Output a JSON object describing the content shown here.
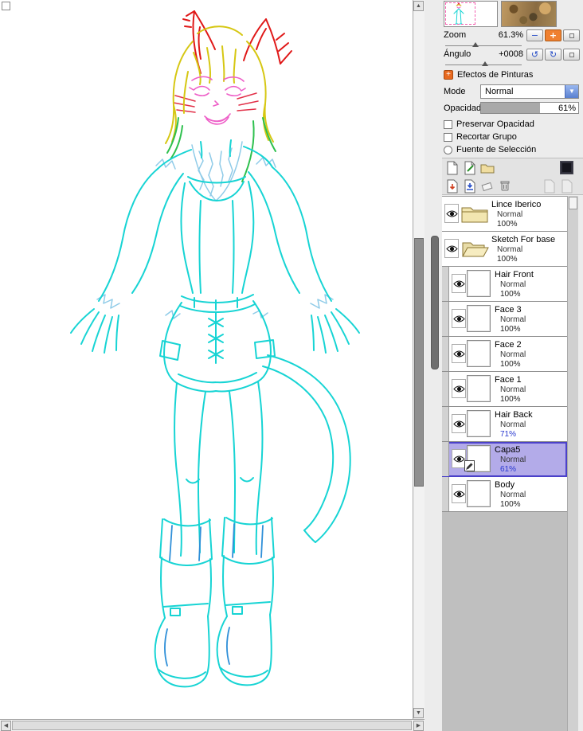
{
  "navigator": {
    "zoom_label": "Zoom",
    "zoom_value": "61.3%",
    "angle_label": "Ángulo",
    "angle_value": "+0008"
  },
  "effects": {
    "header": "Efectos de Pinturas",
    "mode_label": "Mode",
    "mode_value": "Normal",
    "opacity_label": "Opacidad",
    "opacity_value": "61%",
    "checkboxes": [
      {
        "label": "Preservar Opacidad"
      },
      {
        "label": "Recortar Grupo"
      },
      {
        "label": "Fuente de Selección"
      }
    ]
  },
  "layers": [
    {
      "name": "Lince Iberico",
      "mode": "Normal",
      "opacity": "100%"
    },
    {
      "name": "Sketch For base",
      "mode": "Normal",
      "opacity": "100%"
    },
    {
      "name": "Hair Front",
      "mode": "Normal",
      "opacity": "100%"
    },
    {
      "name": "Face 3",
      "mode": "Normal",
      "opacity": "100%"
    },
    {
      "name": "Face 2",
      "mode": "Normal",
      "opacity": "100%"
    },
    {
      "name": "Face 1",
      "mode": "Normal",
      "opacity": "100%"
    },
    {
      "name": "Hair Back",
      "mode": "Normal",
      "opacity": "71%"
    },
    {
      "name": "Capa5",
      "mode": "Normal",
      "opacity": "61%"
    },
    {
      "name": "Body",
      "mode": "Normal",
      "opacity": "100%"
    }
  ],
  "icons": {
    "minus": "−",
    "plus": "+",
    "rotate_ccw": "↺",
    "rotate_cw": "↻",
    "dropdown_arrow": "▼",
    "up_arrow": "▲",
    "down_arrow": "▼",
    "left_arrow": "◀",
    "right_arrow": "▶",
    "effects_plus": "+"
  },
  "colors": {
    "selected_layer_bg": "#b3abe9",
    "selected_layer_border": "#4b41c9",
    "opacity_fill": "#a9a9a9",
    "selection_dash": "#f45fb0"
  },
  "artwork": {
    "ears": "#e01818",
    "whiskers": "#e23048",
    "hair": "#d6c713",
    "green": "#2ec04e",
    "face": "#ee5fc8",
    "fluff": "#8fcbe8",
    "body": "#17d4d4",
    "boots": "#2f8fd8"
  }
}
